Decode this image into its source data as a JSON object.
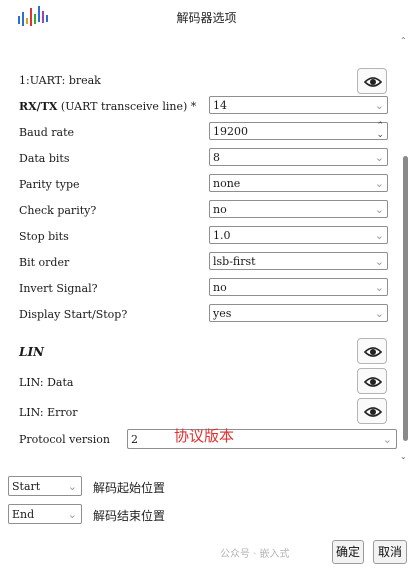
{
  "window": {
    "title": "解码器选项"
  },
  "options": [
    {
      "label": "1:UART: break",
      "type": "eye"
    },
    {
      "label": "RX/TX",
      "label_suffix": "(UART transceive line) *",
      "type": "select",
      "value": "14"
    },
    {
      "label": "Baud rate",
      "type": "spin",
      "value": "19200"
    },
    {
      "label": "Data bits",
      "type": "select",
      "value": "8"
    },
    {
      "label": "Parity type",
      "type": "select",
      "value": "none"
    },
    {
      "label": "Check parity?",
      "type": "select",
      "value": "no"
    },
    {
      "label": "Stop bits",
      "type": "select",
      "value": "1.0"
    },
    {
      "label": "Bit order",
      "type": "select",
      "value": "lsb-first"
    },
    {
      "label": "Invert Signal?",
      "type": "select",
      "value": "no"
    },
    {
      "label": "Display Start/Stop?",
      "type": "select",
      "value": "yes"
    }
  ],
  "lin": {
    "header": "LIN",
    "data_label": "LIN: Data",
    "error_label": "LIN: Error",
    "protocol_label": "Protocol version",
    "protocol_value": "2",
    "annotation": "协议版本"
  },
  "range": {
    "start_value": "Start",
    "start_label": "解码起始位置",
    "end_value": "End",
    "end_label": "解码结束位置"
  },
  "watermark": "公众号 · 嵌入式",
  "buttons": {
    "ok": "确定",
    "cancel": "取消"
  },
  "icons": {
    "eye": "eye-icon",
    "chevron": "chevron-down-icon",
    "spin": "spin-arrows-icon"
  }
}
